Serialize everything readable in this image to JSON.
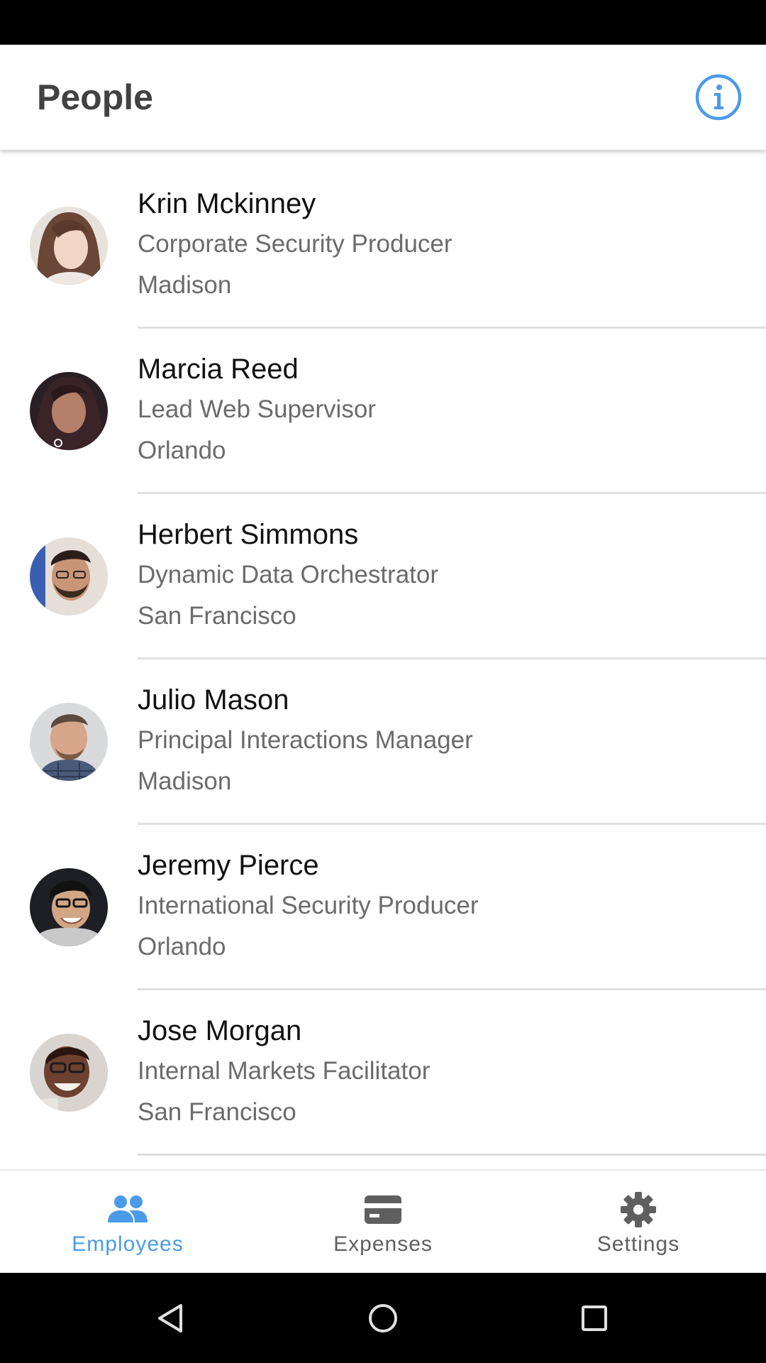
{
  "app_bar": {
    "title": "People",
    "info_icon": "info-circle-icon",
    "accent_color": "#4a9be8"
  },
  "people": [
    {
      "name": "Krin Mckinney",
      "title": "Corporate Security Producer",
      "location": "Madison"
    },
    {
      "name": "Marcia Reed",
      "title": "Lead Web Supervisor",
      "location": "Orlando"
    },
    {
      "name": "Herbert Simmons",
      "title": "Dynamic Data Orchestrator",
      "location": "San Francisco"
    },
    {
      "name": "Julio Mason",
      "title": "Principal Interactions Manager",
      "location": "Madison"
    },
    {
      "name": "Jeremy Pierce",
      "title": "International Security Producer",
      "location": "Orlando"
    },
    {
      "name": "Jose Morgan",
      "title": "Internal Markets Facilitator",
      "location": "San Francisco"
    }
  ],
  "bottom_nav": {
    "items": [
      {
        "label": "Employees",
        "icon": "people-icon",
        "active": true
      },
      {
        "label": "Expenses",
        "icon": "credit-card-icon",
        "active": false
      },
      {
        "label": "Settings",
        "icon": "gear-icon",
        "active": false
      }
    ],
    "active_color": "#4a9be8",
    "inactive_color": "#5f5f5f"
  },
  "system_nav": {
    "icons": [
      "back-triangle-icon",
      "home-circle-icon",
      "recents-square-icon"
    ]
  }
}
